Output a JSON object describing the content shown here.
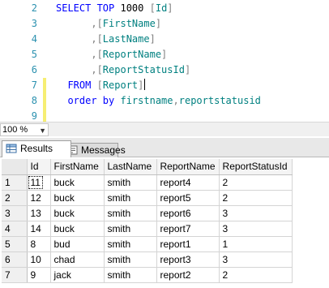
{
  "editor": {
    "lines": [
      {
        "num": "2",
        "changed": false,
        "parts": [
          {
            "t": "kw",
            "v": "SELECT TOP "
          },
          {
            "t": "bk",
            "v": "1000 "
          },
          {
            "t": "gr",
            "v": "["
          },
          {
            "t": "id",
            "v": "Id"
          },
          {
            "t": "gr",
            "v": "]"
          }
        ]
      },
      {
        "num": "3",
        "changed": false,
        "parts": [
          {
            "t": "gr",
            "v": "      ,["
          },
          {
            "t": "id",
            "v": "FirstName"
          },
          {
            "t": "gr",
            "v": "]"
          }
        ]
      },
      {
        "num": "4",
        "changed": false,
        "parts": [
          {
            "t": "gr",
            "v": "      ,["
          },
          {
            "t": "id",
            "v": "LastName"
          },
          {
            "t": "gr",
            "v": "]"
          }
        ]
      },
      {
        "num": "5",
        "changed": false,
        "parts": [
          {
            "t": "gr",
            "v": "      ,["
          },
          {
            "t": "id",
            "v": "ReportName"
          },
          {
            "t": "gr",
            "v": "]"
          }
        ]
      },
      {
        "num": "6",
        "changed": false,
        "parts": [
          {
            "t": "gr",
            "v": "      ,["
          },
          {
            "t": "id",
            "v": "ReportStatusId"
          },
          {
            "t": "gr",
            "v": "]"
          }
        ]
      },
      {
        "num": "7",
        "changed": true,
        "caret": true,
        "parts": [
          {
            "t": "kw",
            "v": "  FROM "
          },
          {
            "t": "gr",
            "v": "["
          },
          {
            "t": "id",
            "v": "Report"
          },
          {
            "t": "gr",
            "v": "]"
          }
        ]
      },
      {
        "num": "8",
        "changed": true,
        "parts": [
          {
            "t": "kw",
            "v": "  order by "
          },
          {
            "t": "id",
            "v": "firstname"
          },
          {
            "t": "gr",
            "v": ","
          },
          {
            "t": "id",
            "v": "reportstatusid"
          }
        ]
      },
      {
        "num": "9",
        "changed": true,
        "parts": []
      }
    ]
  },
  "zoom": {
    "value": "100 %",
    "arrow": "▼"
  },
  "tabs": {
    "results": "Results",
    "messages": "Messages"
  },
  "grid": {
    "columns": [
      "Id",
      "FirstName",
      "LastName",
      "ReportName",
      "ReportStatusId"
    ],
    "rows": [
      {
        "n": "1",
        "cells": [
          "11",
          "buck",
          "smith",
          "report4",
          "2"
        ]
      },
      {
        "n": "2",
        "cells": [
          "12",
          "buck",
          "smith",
          "report5",
          "2"
        ]
      },
      {
        "n": "3",
        "cells": [
          "13",
          "buck",
          "smith",
          "report6",
          "3"
        ]
      },
      {
        "n": "4",
        "cells": [
          "14",
          "buck",
          "smith",
          "report7",
          "3"
        ]
      },
      {
        "n": "5",
        "cells": [
          "8",
          "bud",
          "smith",
          "report1",
          "1"
        ]
      },
      {
        "n": "6",
        "cells": [
          "10",
          "chad",
          "smith",
          "report3",
          "3"
        ]
      },
      {
        "n": "7",
        "cells": [
          "9",
          "jack",
          "smith",
          "report2",
          "2"
        ]
      }
    ],
    "selected_cell": {
      "row": 0,
      "col": 0
    }
  }
}
